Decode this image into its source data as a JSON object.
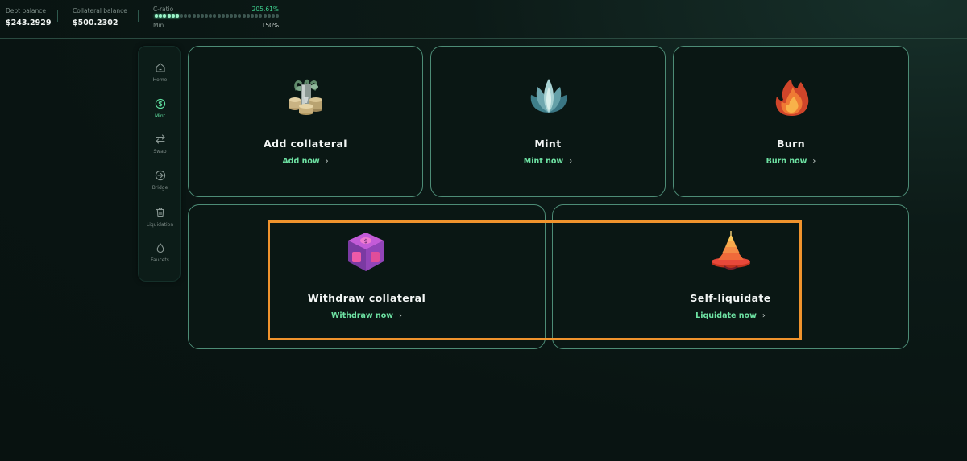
{
  "header": {
    "debt_label": "Debt balance",
    "debt_value": "$243.2929",
    "collateral_label": "Collateral balance",
    "collateral_value": "$500.2302",
    "cratio_label": "C-ratio",
    "cratio_value": "205.61%",
    "min_label": "Min",
    "min_value": "150%",
    "progress_segments_total": 30,
    "progress_segments_filled": 6
  },
  "sidebar": {
    "items": [
      {
        "label": "Home",
        "icon": "home-icon",
        "active": false
      },
      {
        "label": "Mint",
        "icon": "dollar-circle-icon",
        "active": true
      },
      {
        "label": "Swap",
        "icon": "swap-arrows-icon",
        "active": false
      },
      {
        "label": "Bridge",
        "icon": "arrow-circle-icon",
        "active": false
      },
      {
        "label": "Liquidation",
        "icon": "trash-icon",
        "active": false
      },
      {
        "label": "Faucets",
        "icon": "droplet-icon",
        "active": false
      }
    ]
  },
  "cards": [
    {
      "title": "Add collateral",
      "link": "Add now",
      "icon": "coins-plant-icon"
    },
    {
      "title": "Mint",
      "link": "Mint now",
      "icon": "teal-lotus-icon"
    },
    {
      "title": "Burn",
      "link": "Burn now",
      "icon": "flame-icon"
    },
    {
      "title": "Withdraw collateral",
      "link": "Withdraw now",
      "icon": "vault-cube-icon"
    },
    {
      "title": "Self-liquidate",
      "link": "Liquidate now",
      "icon": "pagoda-icon"
    }
  ],
  "colors": {
    "accent": "#6ee2a3",
    "card_border": "#4d8c76",
    "highlight": "#f0932d",
    "background": "#091412"
  }
}
